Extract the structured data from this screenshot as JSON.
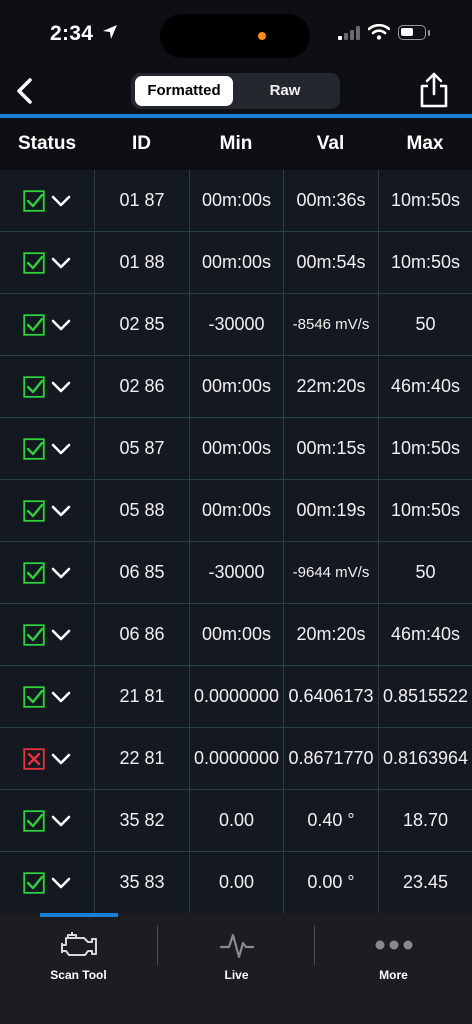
{
  "status_bar": {
    "time": "2:34"
  },
  "nav": {
    "segments": [
      {
        "label": "Formatted",
        "selected": true
      },
      {
        "label": "Raw",
        "selected": false
      }
    ]
  },
  "table": {
    "headers": [
      "Status",
      "ID",
      "Min",
      "Val",
      "Max"
    ],
    "rows": [
      {
        "status": "pass",
        "id": "01 87",
        "min": "00m:00s",
        "val": "00m:36s",
        "max": "10m:50s"
      },
      {
        "status": "pass",
        "id": "01 88",
        "min": "00m:00s",
        "val": "00m:54s",
        "max": "10m:50s"
      },
      {
        "status": "pass",
        "id": "02 85",
        "min": "-30000",
        "val": "-8546 mV/s",
        "max": "50"
      },
      {
        "status": "pass",
        "id": "02 86",
        "min": "00m:00s",
        "val": "22m:20s",
        "max": "46m:40s"
      },
      {
        "status": "pass",
        "id": "05 87",
        "min": "00m:00s",
        "val": "00m:15s",
        "max": "10m:50s"
      },
      {
        "status": "pass",
        "id": "05 88",
        "min": "00m:00s",
        "val": "00m:19s",
        "max": "10m:50s"
      },
      {
        "status": "pass",
        "id": "06 85",
        "min": "-30000",
        "val": "-9644 mV/s",
        "max": "50"
      },
      {
        "status": "pass",
        "id": "06 86",
        "min": "00m:00s",
        "val": "20m:20s",
        "max": "46m:40s"
      },
      {
        "status": "pass",
        "id": "21 81",
        "min": "0.0000000",
        "val": "0.6406173",
        "max": "0.8515522"
      },
      {
        "status": "fail",
        "id": "22 81",
        "min": "0.0000000",
        "val": "0.8671770",
        "max": "0.8163964"
      },
      {
        "status": "pass",
        "id": "35 82",
        "min": "0.00",
        "val": "0.40 °",
        "max": "18.70"
      },
      {
        "status": "pass",
        "id": "35 83",
        "min": "0.00",
        "val": "0.00 °",
        "max": "23.45"
      }
    ]
  },
  "tabs": [
    {
      "label": "Scan Tool",
      "icon": "engine-icon",
      "active": true
    },
    {
      "label": "Live",
      "icon": "pulse-icon",
      "active": false
    },
    {
      "label": "More",
      "icon": "ellipsis-icon",
      "active": false
    }
  ],
  "colors": {
    "accent": "#1c7fd6",
    "pass": "#2fd13a",
    "fail": "#e8333a",
    "background": "#0d0f14"
  }
}
